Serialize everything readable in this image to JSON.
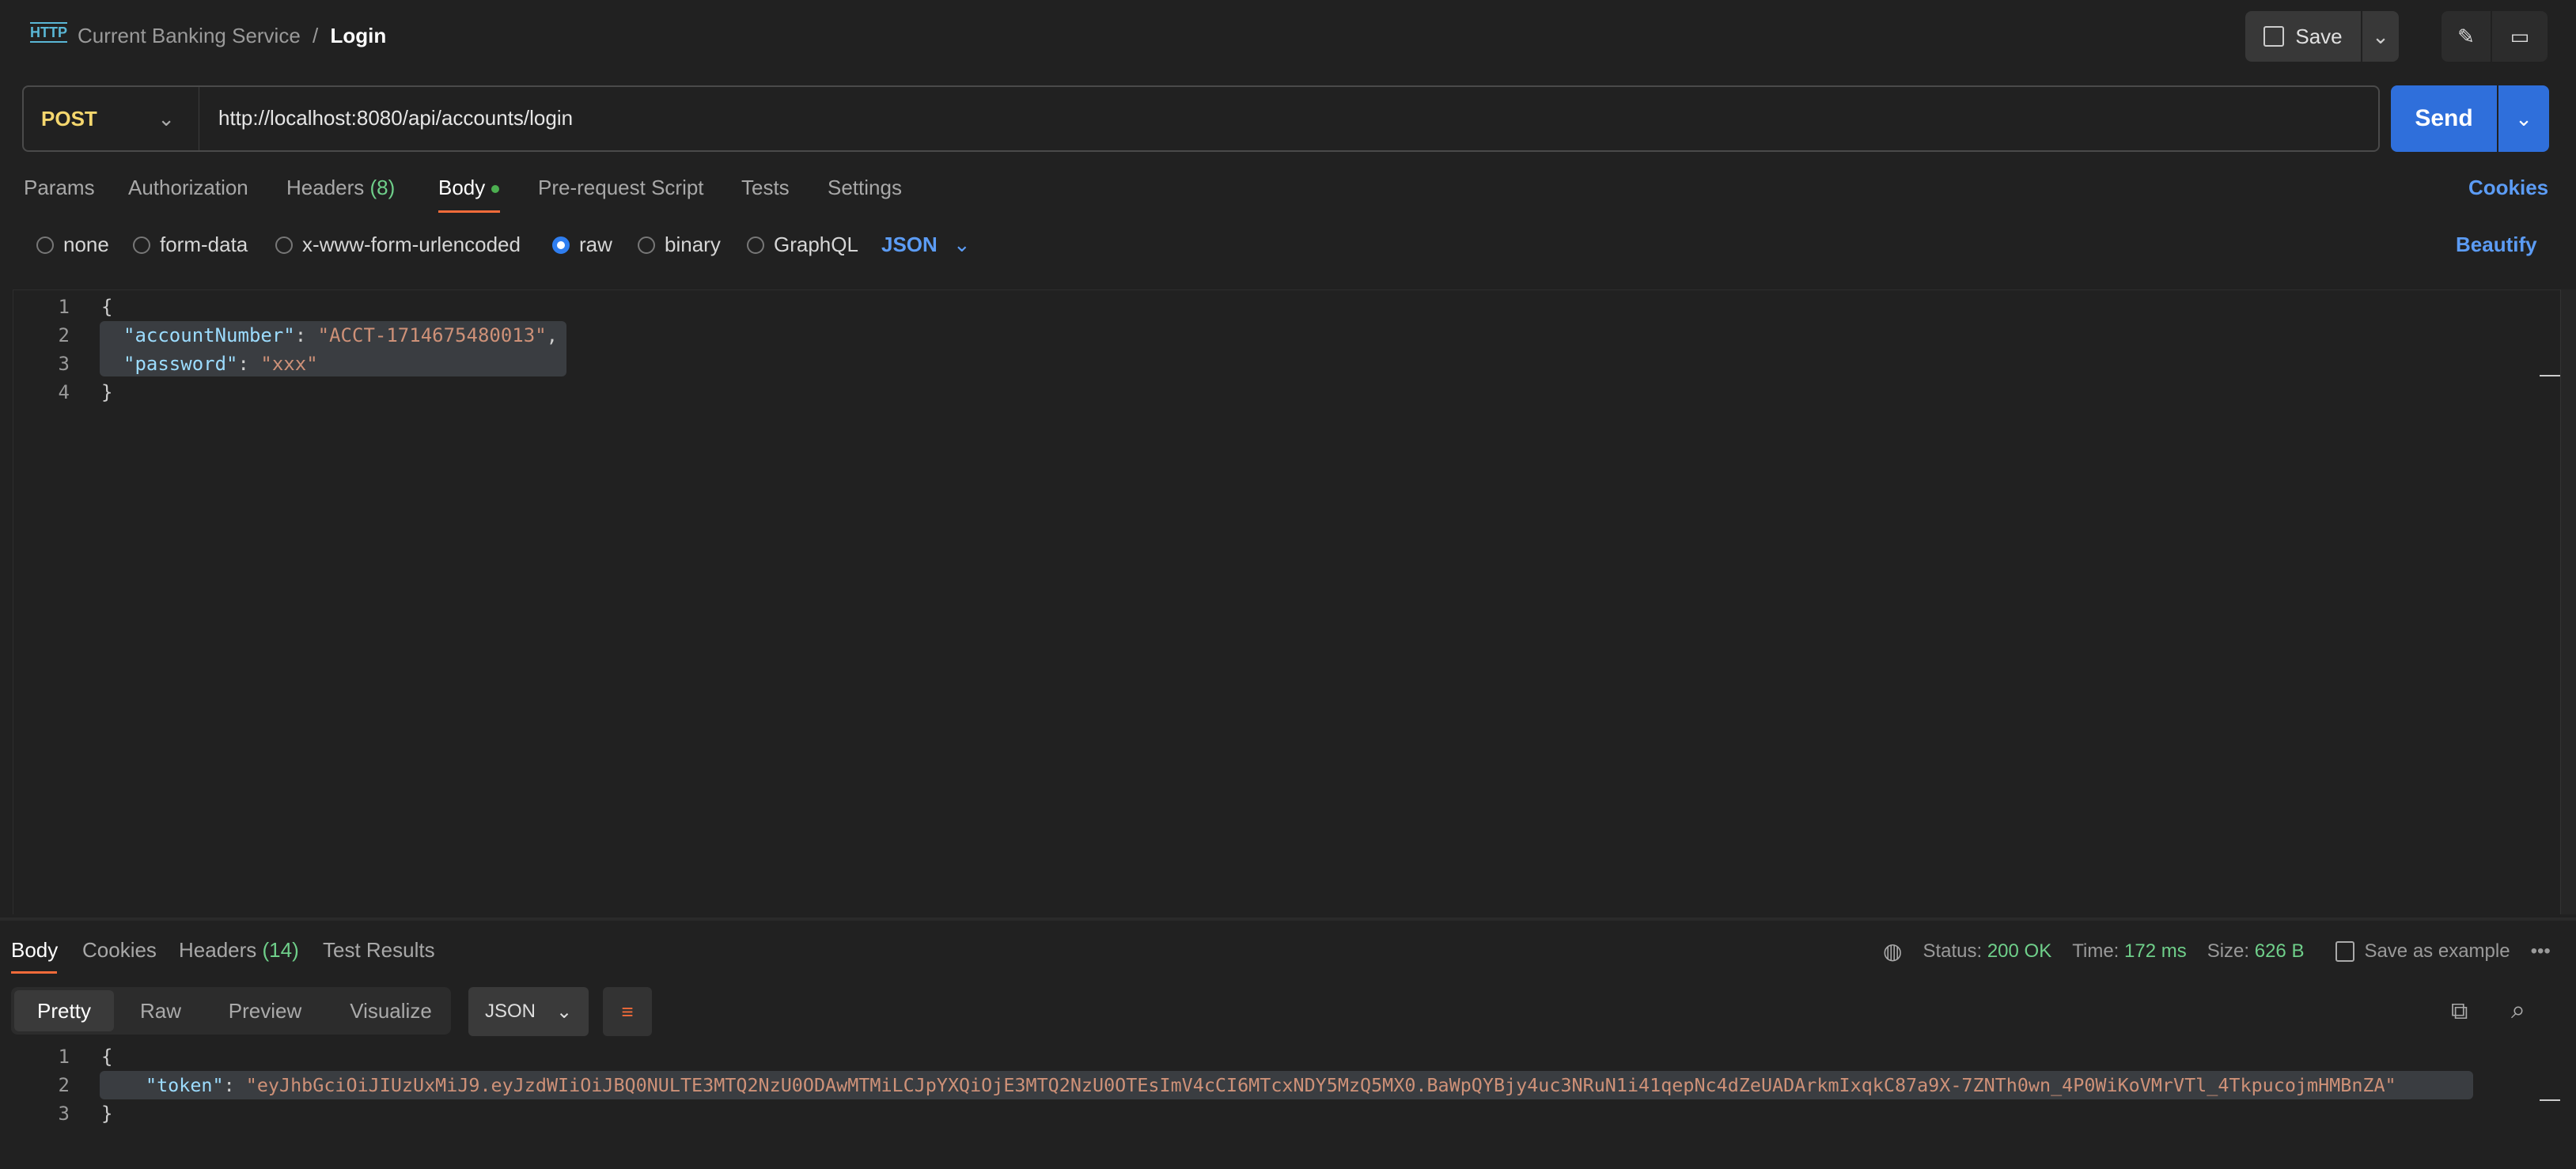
{
  "header": {
    "collection": "Current Banking Service",
    "separator": "/",
    "request_name": "Login",
    "save_label": "Save",
    "icon": "http-icon"
  },
  "request": {
    "method": "POST",
    "url": "http://localhost:8080/api/accounts/login",
    "send_label": "Send"
  },
  "tabs": [
    {
      "label": "Params"
    },
    {
      "label": "Authorization"
    },
    {
      "label": "Headers",
      "count": "(8)"
    },
    {
      "label": "Body",
      "active": true
    },
    {
      "label": "Pre-request Script"
    },
    {
      "label": "Tests"
    },
    {
      "label": "Settings"
    }
  ],
  "cookies_label": "Cookies",
  "body_types": [
    {
      "label": "none"
    },
    {
      "label": "form-data"
    },
    {
      "label": "x-www-form-urlencoded"
    },
    {
      "label": "raw",
      "selected": true
    },
    {
      "label": "binary"
    },
    {
      "label": "GraphQL"
    }
  ],
  "raw_format": "JSON",
  "beautify_label": "Beautify",
  "request_body": {
    "lines": [
      "1",
      "2",
      "3",
      "4"
    ],
    "open": "{",
    "k1": "\"accountNumber\"",
    "v1": "\"ACCT-1714675480013\"",
    "k2": "\"password\"",
    "v2": "\"xxx\"",
    "close": "}"
  },
  "response": {
    "tabs": [
      {
        "label": "Body"
      },
      {
        "label": "Cookies"
      },
      {
        "label": "Headers",
        "count": "(14)"
      },
      {
        "label": "Test Results"
      }
    ],
    "status_label": "Status:",
    "status": "200 OK",
    "time_label": "Time:",
    "time": "172 ms",
    "size_label": "Size:",
    "size": "626 B",
    "save_example": "Save as example",
    "views": [
      "Pretty",
      "Raw",
      "Preview",
      "Visualize"
    ],
    "format": "JSON",
    "lines": [
      "1",
      "2",
      "3"
    ],
    "open": "{",
    "key": "\"token\"",
    "value": "\"eyJhbGciOiJIUzUxMiJ9.eyJzdWIiOiJBQ0NULTE3MTQ2NzU0ODAwMTMiLCJpYXQiOjE3MTQ2NzU0OTEsImV4cCI6MTcxNDY5MzQ5MX0.BaWpQYBjy4uc3NRuN1i41qepNc4dZeUADArkmIxqkC87a9X-7ZNTh0wn_4P0WiKoVMrVTl_4TkpucojmHMBnZA\"",
    "close": "}"
  },
  "colors": {
    "accent": "#2f6fdb",
    "method": "#f5d76e",
    "active_tab": "#f26b3a",
    "ok": "#6fcf8a"
  }
}
